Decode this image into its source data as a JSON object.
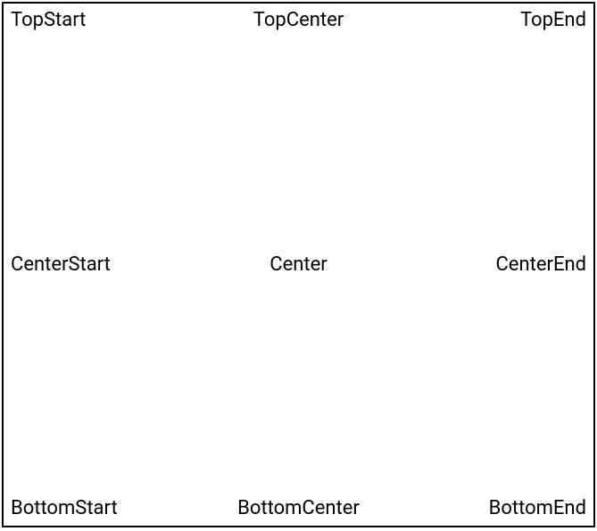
{
  "alignment": {
    "topStart": "TopStart",
    "topCenter": "TopCenter",
    "topEnd": "TopEnd",
    "centerStart": "CenterStart",
    "center": "Center",
    "centerEnd": "CenterEnd",
    "bottomStart": "BottomStart",
    "bottomCenter": "BottomCenter",
    "bottomEnd": "BottomEnd"
  }
}
